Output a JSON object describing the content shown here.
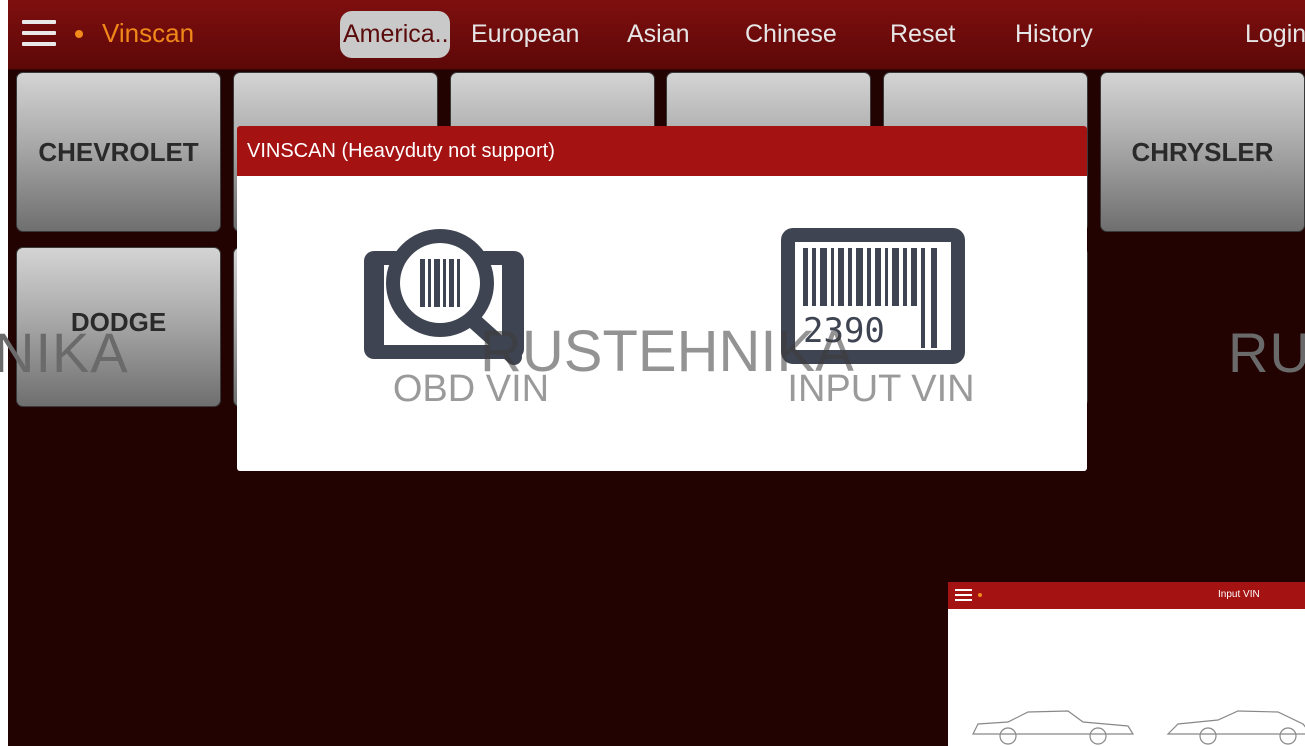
{
  "app": {
    "title": "Vinscan"
  },
  "tabs": [
    {
      "label": "America..",
      "active": true
    },
    {
      "label": "European"
    },
    {
      "label": "Asian"
    },
    {
      "label": "Chinese"
    },
    {
      "label": "Reset"
    },
    {
      "label": "History"
    },
    {
      "label": "Login"
    }
  ],
  "brands": [
    "CHEVROLET",
    "CHRYSLER",
    "DODGE"
  ],
  "watermark": {
    "left": "NIKA",
    "center": "RUSTEHNIKA",
    "right": "RU"
  },
  "dialog": {
    "title": "VINSCAN (Heavyduty not support)",
    "options": [
      {
        "label": "OBD VIN",
        "icon": "magnifier-barcode-icon"
      },
      {
        "label": "INPUT VIN",
        "icon": "barcode-icon",
        "barcode_digits": "2390"
      }
    ]
  },
  "thumbnail": {
    "title": "Input VIN"
  },
  "colors": {
    "header": "#a41212",
    "accent": "#f0881a",
    "background": "#230202"
  }
}
